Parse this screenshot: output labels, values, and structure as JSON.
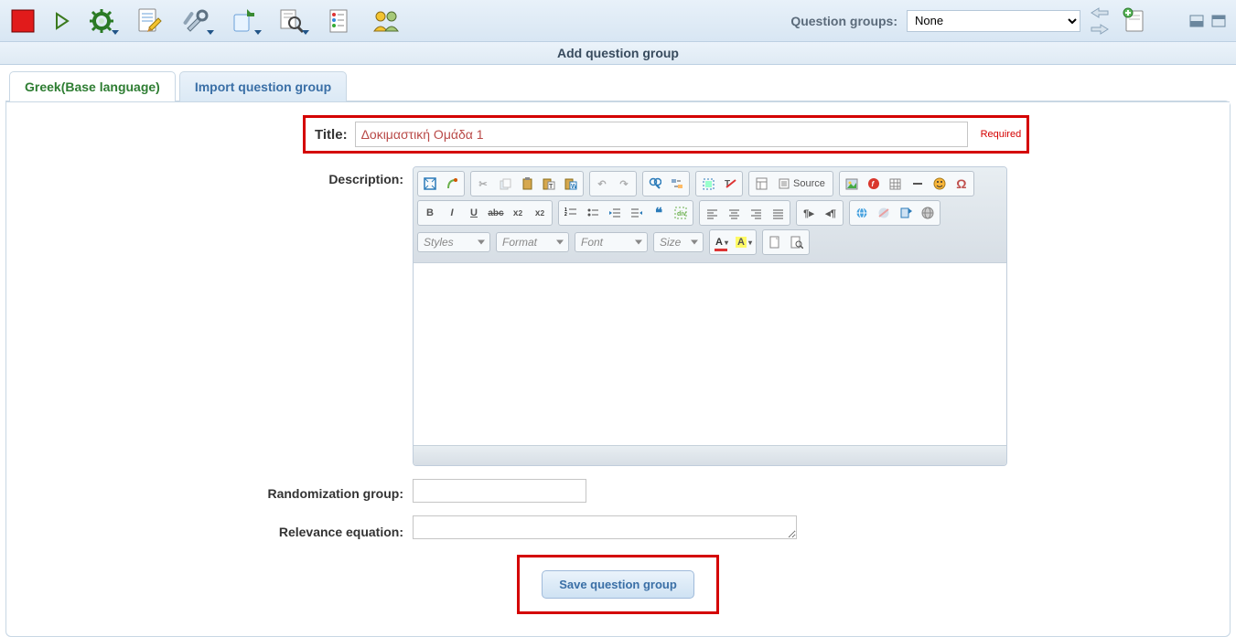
{
  "toolbar": {
    "question_groups_label": "Question groups:",
    "question_groups_selected": "None"
  },
  "subheader": "Add question group",
  "tabs": {
    "active": "Greek(Base language)",
    "import": "Import question group"
  },
  "form": {
    "title_label": "Title:",
    "title_value": "Δοκιμαστική Ομάδα 1",
    "title_required": "Required",
    "description_label": "Description:",
    "randomization_label": "Randomization group:",
    "randomization_value": "",
    "relevance_label": "Relevance equation:",
    "relevance_value": ""
  },
  "ckeditor": {
    "source": "Source",
    "styles": "Styles",
    "format": "Format",
    "font": "Font",
    "size": "Size"
  },
  "buttons": {
    "save": "Save question group"
  }
}
